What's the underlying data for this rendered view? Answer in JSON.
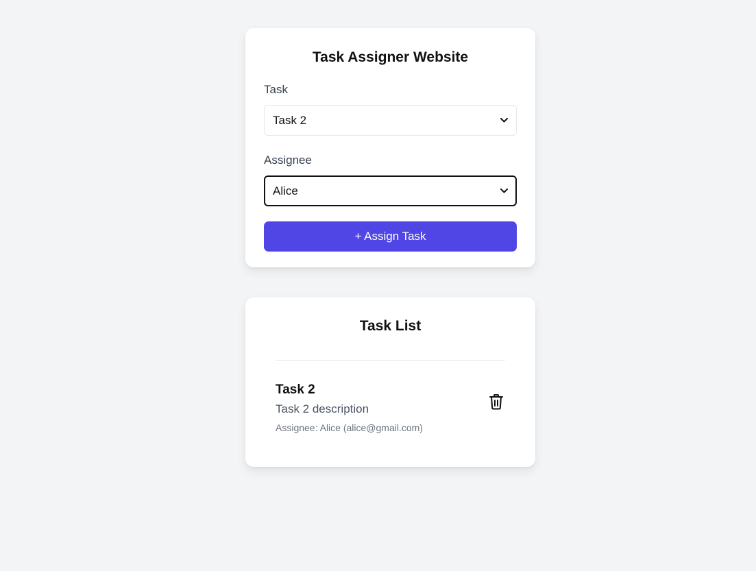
{
  "form": {
    "title": "Task Assigner Website",
    "task_label": "Task",
    "task_selected": "Task 2",
    "assignee_label": "Assignee",
    "assignee_selected": "Alice",
    "assign_button_label": "+ Assign Task"
  },
  "task_list": {
    "title": "Task List",
    "items": [
      {
        "name": "Task 2",
        "description": "Task 2 description",
        "assignee_text": "Assignee: Alice (alice@gmail.com)",
        "delete_icon": "trash-icon"
      }
    ]
  },
  "colors": {
    "page_background": "#f3f4f6",
    "card_background": "#ffffff",
    "accent": "#4f46e5",
    "focus_border": "#111111"
  },
  "icons": {
    "select_chevron": "chevron-down-icon",
    "delete": "trash-icon"
  }
}
